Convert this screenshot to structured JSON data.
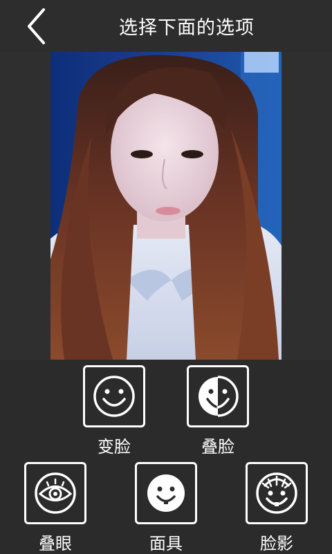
{
  "header": {
    "title": "选择下面的选项",
    "back_icon": "chevron-left-icon"
  },
  "photo": {
    "description_icon": "portrait-photo"
  },
  "options": [
    {
      "label": "变脸",
      "icon": "smiley-face-icon"
    },
    {
      "label": "叠脸",
      "icon": "half-face-icon"
    },
    {
      "label": "叠眼",
      "icon": "eye-icon"
    },
    {
      "label": "面具",
      "icon": "mask-face-icon"
    },
    {
      "label": "脸影",
      "icon": "sunburst-face-icon"
    }
  ]
}
